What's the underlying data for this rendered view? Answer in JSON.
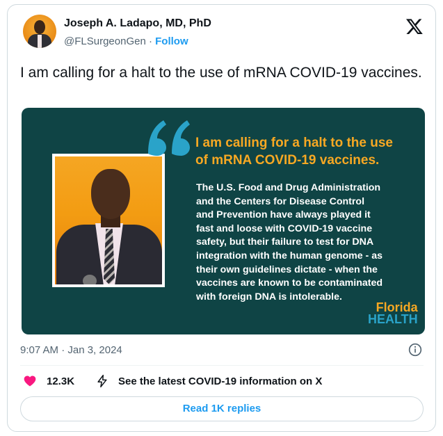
{
  "author": {
    "name": "Joseph A. Ladapo, MD, PhD",
    "handle": "@FLSurgeonGen",
    "separator": "·",
    "follow_label": "Follow"
  },
  "tweet": {
    "text": "I am calling for a halt to the use of mRNA COVID-19 vaccines.",
    "timestamp": "9:07 AM · Jan 3, 2024"
  },
  "media": {
    "headline_line1": "I am calling for a halt to the use",
    "headline_line2": "of mRNA COVID-19 vaccines.",
    "body_lines": [
      "The U.S. Food and Drug Administration",
      "and the Centers for Disease Control",
      "and Prevention have always played it",
      "fast and loose with COVID-19 vaccine",
      "safety, but their failure to test for DNA",
      "integration with the human genome - as",
      "their own guidelines dictate - when the",
      "vaccines are known to be contaminated",
      "with foreign DNA is intolerable."
    ],
    "logo_line1": "Florida",
    "logo_line2": "HEALTH",
    "colors": {
      "background": "#0f4445",
      "accent": "#f7a823",
      "quote": "#2aa3c9"
    }
  },
  "actions": {
    "like_count": "12.3K",
    "see_latest": "See the latest COVID-19 information on X",
    "read_replies": "Read 1K replies"
  },
  "icons": {
    "logo": "x-logo-icon",
    "like": "heart-icon",
    "info": "info-icon",
    "latest": "lightning-icon"
  }
}
